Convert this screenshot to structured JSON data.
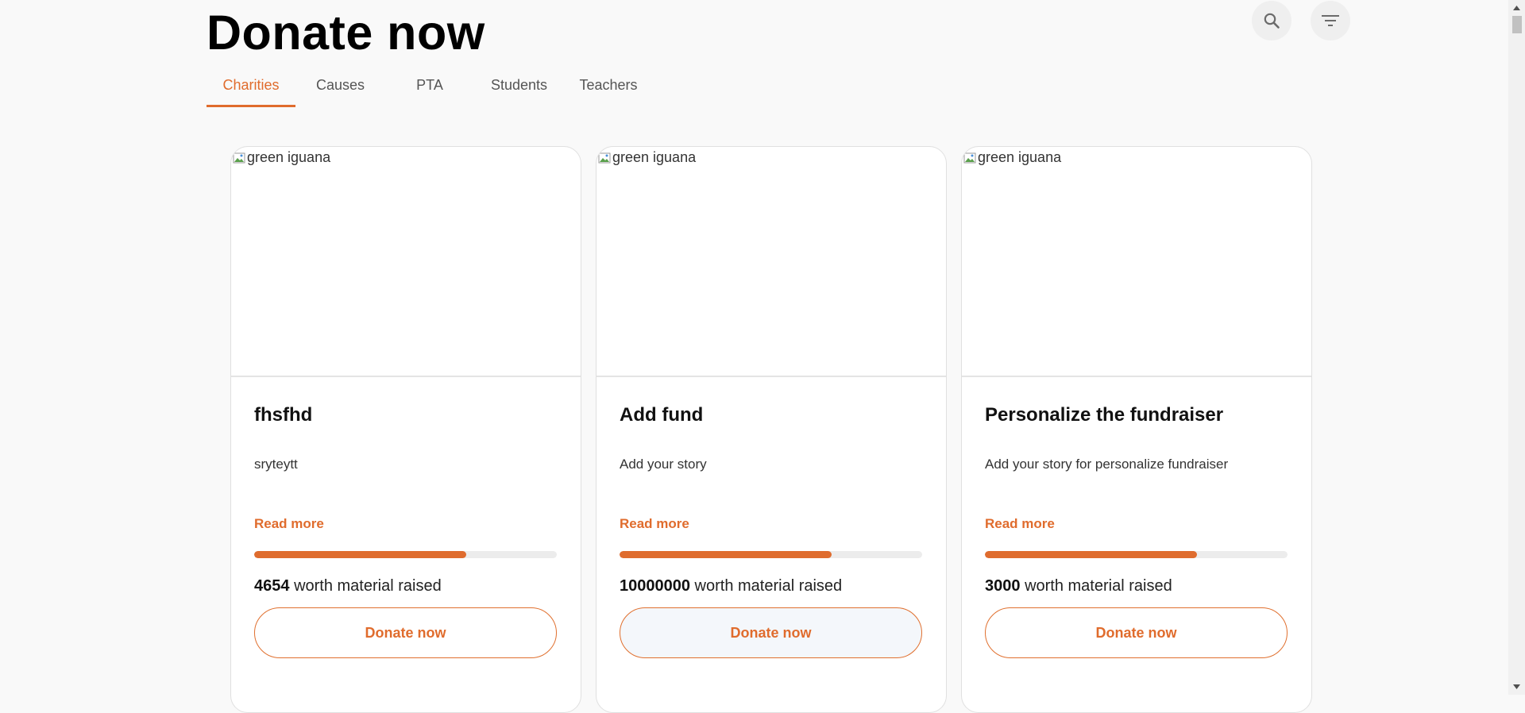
{
  "header": {
    "title": "Donate now",
    "search_icon": "search-icon",
    "filter_icon": "filter-icon"
  },
  "tabs": [
    {
      "label": "Charities",
      "active": true
    },
    {
      "label": "Causes",
      "active": false
    },
    {
      "label": "PTA",
      "active": false
    },
    {
      "label": "Students",
      "active": false
    },
    {
      "label": "Teachers",
      "active": false
    }
  ],
  "cards": [
    {
      "image_alt": "green iguana",
      "title": "fhsfhd",
      "description": "sryteytt",
      "read_more": "Read more",
      "progress": 0.7,
      "amount": "4654",
      "raised_suffix": "worth material raised",
      "button": "Donate now"
    },
    {
      "image_alt": "green iguana",
      "title": "Add fund",
      "description": "Add your story",
      "read_more": "Read more",
      "progress": 0.7,
      "amount": "10000000",
      "raised_suffix": "worth material raised",
      "button": "Donate now"
    },
    {
      "image_alt": "green iguana",
      "title": "Personalize the fundraiser",
      "description": "Add your story for personalize fundraiser",
      "read_more": "Read more",
      "progress": 0.7,
      "amount": "3000",
      "raised_suffix": "worth material raised",
      "button": "Donate now"
    }
  ],
  "colors": {
    "accent": "#e06c2d",
    "progress_track": "#ececec",
    "background": "#f9f9f9"
  }
}
